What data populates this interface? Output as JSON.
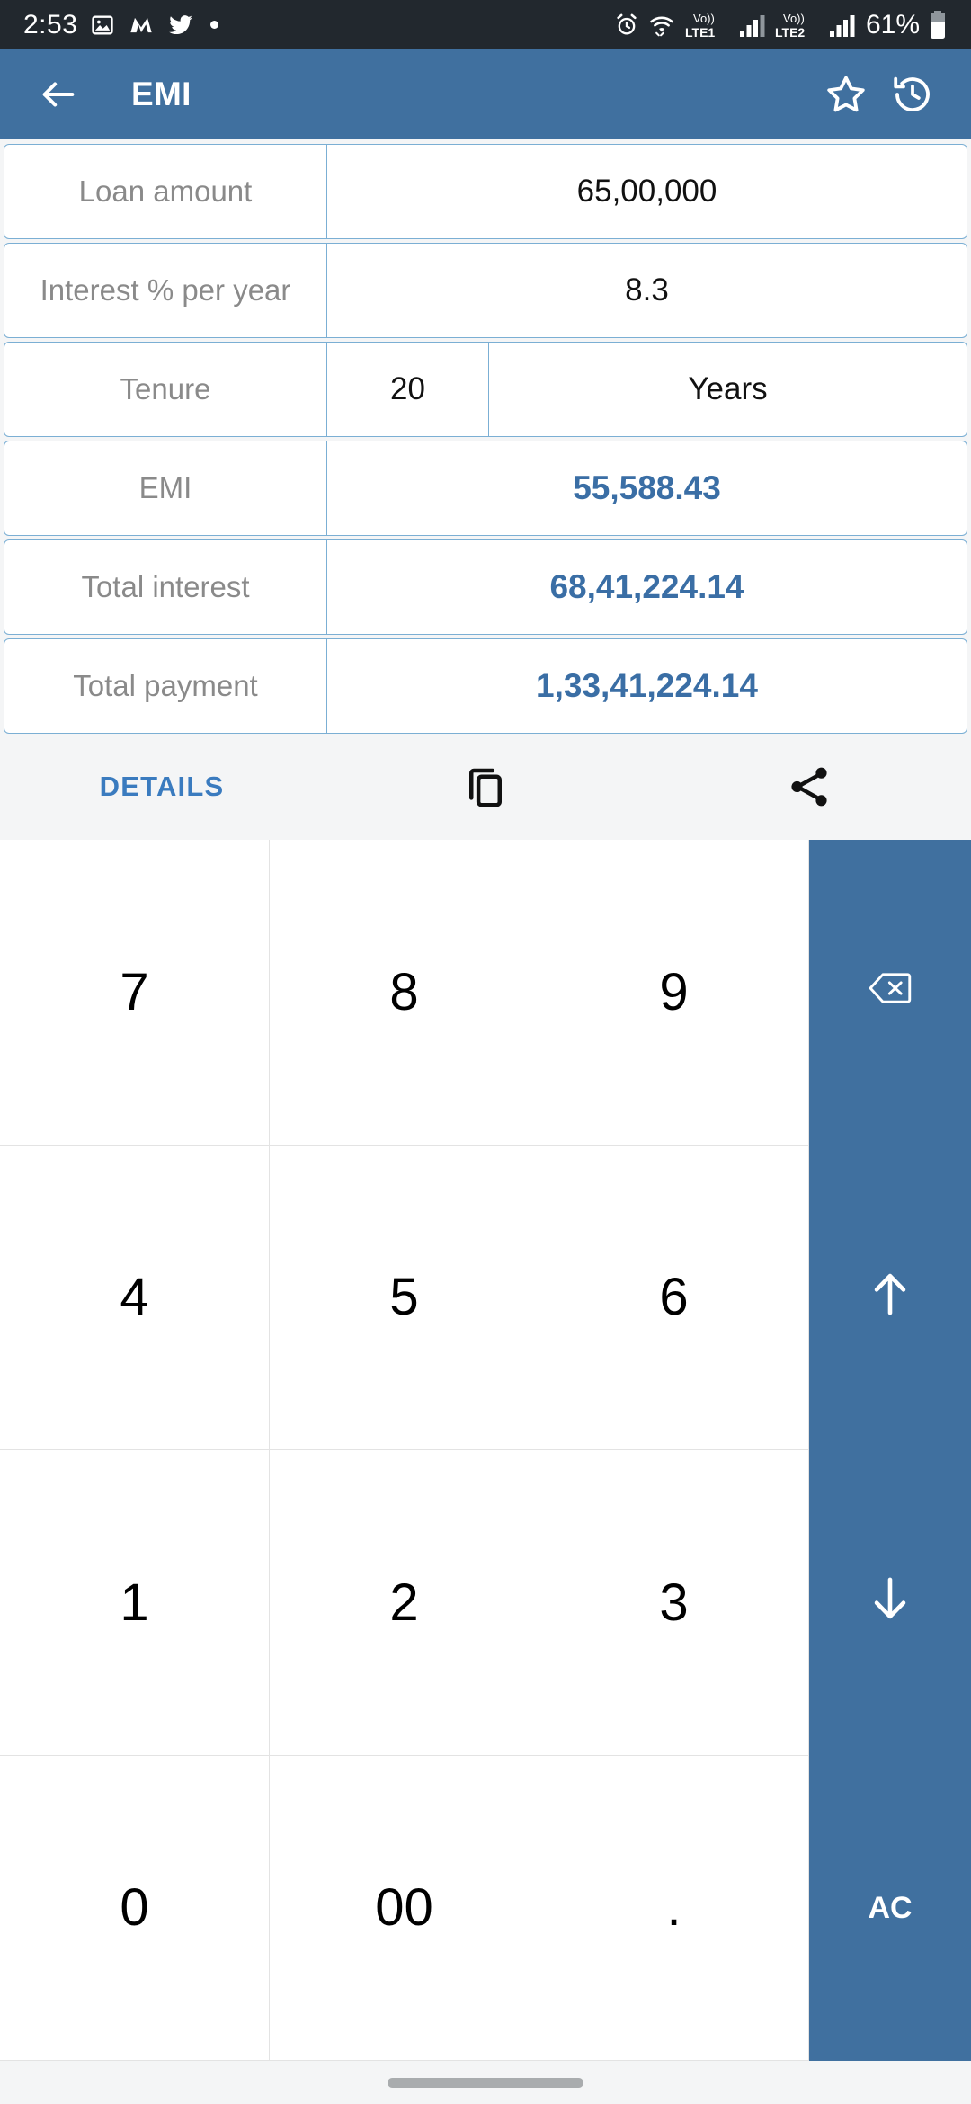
{
  "status_bar": {
    "time": "2:53",
    "battery": "61%",
    "left_icons": [
      "gallery-icon",
      "m-app-icon",
      "twitter-icon",
      "dot-icon"
    ],
    "right_icons": [
      "alarm-icon",
      "wifi-icon",
      "volte1-icon",
      "signal1-icon",
      "volte2-icon",
      "signal2-icon",
      "battery-icon"
    ],
    "network_labels": [
      "Vo)) LTE1",
      "Vo)) LTE2"
    ]
  },
  "app_bar": {
    "title": "EMI",
    "back_icon": "back-arrow-icon",
    "favorite_icon": "star-icon",
    "history_icon": "history-icon",
    "background": "#40709f"
  },
  "fields": [
    {
      "label": "Loan amount",
      "value": "65,00,000",
      "type": "input",
      "unit": null
    },
    {
      "label": "Interest % per year",
      "value": "8.3",
      "type": "input",
      "unit": null
    },
    {
      "label": "Tenure",
      "value": "20",
      "type": "input",
      "unit": "Years"
    },
    {
      "label": "EMI",
      "value": "55,588.43",
      "type": "result",
      "unit": null
    },
    {
      "label": "Total interest",
      "value": "68,41,224.14",
      "type": "result",
      "unit": null
    },
    {
      "label": "Total payment",
      "value": "1,33,41,224.14",
      "type": "result",
      "unit": null
    }
  ],
  "action_bar": {
    "details_label": "DETAILS",
    "copy_icon": "copy-icon",
    "share_icon": "share-icon",
    "accent": "#3a7bbf"
  },
  "keypad": {
    "keys": [
      "7",
      "8",
      "9",
      "4",
      "5",
      "6",
      "1",
      "2",
      "3",
      "0",
      "00",
      "."
    ],
    "side_keys": [
      {
        "label": "",
        "icon": "backspace-icon"
      },
      {
        "label": "",
        "icon": "arrow-up-icon"
      },
      {
        "label": "",
        "icon": "arrow-down-icon"
      },
      {
        "label": "AC",
        "icon": null
      }
    ],
    "side_background": "#40709f"
  },
  "nav_bar": {
    "pill": "home-indicator"
  }
}
